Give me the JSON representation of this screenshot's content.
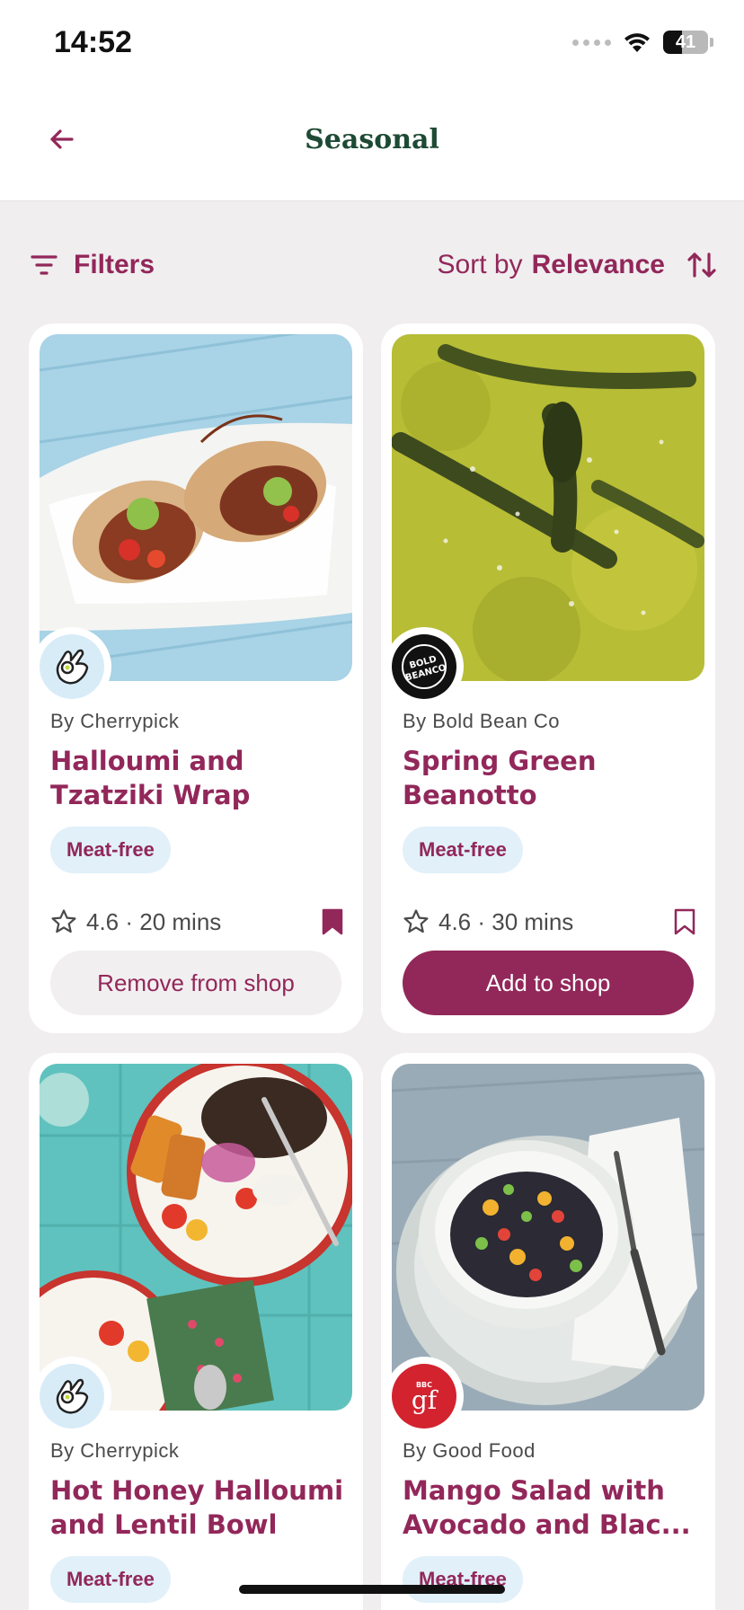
{
  "status_bar": {
    "time": "14:52",
    "battery_level": "41"
  },
  "header": {
    "title": "Seasonal"
  },
  "toolbar": {
    "filters_label": "Filters",
    "sort_prefix": "Sort by",
    "sort_value": "Relevance"
  },
  "colors": {
    "accent": "#92275a",
    "title_green": "#1d4a34",
    "tag_bg": "#e1f0f9",
    "background": "#f0eeef"
  },
  "recipes": [
    {
      "publisher": "By Cherrypick",
      "title_line1": "Halloumi and",
      "title_line2": "Tzatziki Wrap",
      "tag": "Meat-free",
      "meta": "4.6 · 20 mins",
      "saved": true,
      "button_label": "Remove from shop",
      "badge_icon": "cherrypick-hand-icon"
    },
    {
      "publisher": "By Bold Bean Co",
      "title_line1": "Spring Green",
      "title_line2": "Beanotto",
      "tag": "Meat-free",
      "meta": "4.6 · 30 mins",
      "saved": false,
      "button_label": "Add to shop",
      "badge_icon": "bold-bean-logo",
      "badge_text": "BOLD BEANCO"
    },
    {
      "publisher": "By Cherrypick",
      "title_line1": "Hot Honey Halloumi",
      "title_line2": "and Lentil Bowl",
      "tag": "Meat-free",
      "badge_icon": "cherrypick-hand-icon"
    },
    {
      "publisher": "By Good Food",
      "title_line1": "Mango Salad with",
      "title_line2": "Avocado and Blac...",
      "tag": "Meat-free",
      "badge_icon": "bbc-good-food-logo",
      "badge_top": "BBC",
      "badge_text": "gf"
    }
  ]
}
